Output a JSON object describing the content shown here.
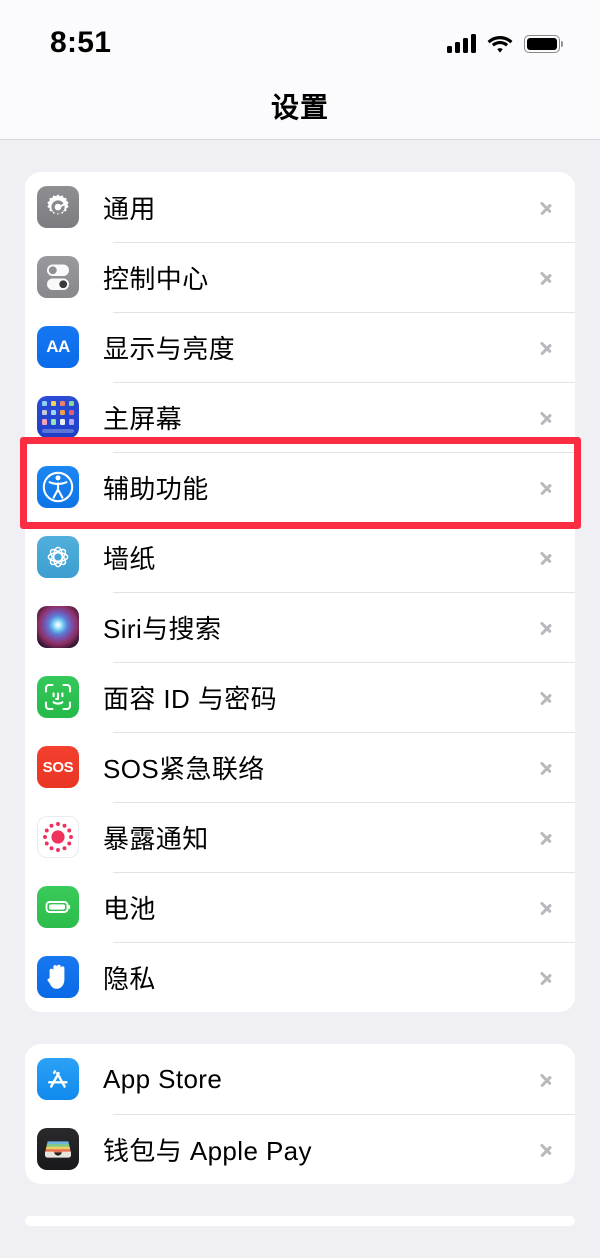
{
  "status_bar": {
    "time": "8:51",
    "icons": [
      "cellular-signal-icon",
      "wifi-icon",
      "battery-icon"
    ],
    "battery_level": 100
  },
  "nav": {
    "title": "设置"
  },
  "highlight": {
    "target": "辅助功能",
    "color": "#FA2D42"
  },
  "groups": [
    {
      "id": "system-group",
      "items": [
        {
          "label": "通用",
          "icon": "gear-icon",
          "chevron": "chevron-right-icon"
        },
        {
          "label": "控制中心",
          "icon": "control-center-icon",
          "chevron": "chevron-right-icon"
        },
        {
          "label": "显示与亮度",
          "icon": "display-brightness-icon",
          "chevron": "chevron-right-icon"
        },
        {
          "label": "主屏幕",
          "icon": "home-screen-icon",
          "chevron": "chevron-right-icon"
        },
        {
          "label": "辅助功能",
          "icon": "accessibility-icon",
          "chevron": "chevron-right-icon"
        },
        {
          "label": "墙纸",
          "icon": "wallpaper-icon",
          "chevron": "chevron-right-icon"
        },
        {
          "label": "Siri与搜索",
          "icon": "siri-icon",
          "chevron": "chevron-right-icon"
        },
        {
          "label": "面容 ID 与密码",
          "icon": "face-id-icon",
          "chevron": "chevron-right-icon"
        },
        {
          "label": "SOS紧急联络",
          "icon": "sos-icon",
          "chevron": "chevron-right-icon"
        },
        {
          "label": "暴露通知",
          "icon": "exposure-notification-icon",
          "chevron": "chevron-right-icon"
        },
        {
          "label": "电池",
          "icon": "battery-settings-icon",
          "chevron": "chevron-right-icon"
        },
        {
          "label": "隐私",
          "icon": "privacy-hand-icon",
          "chevron": "chevron-right-icon"
        }
      ]
    },
    {
      "id": "store-group",
      "items": [
        {
          "label": "App Store",
          "icon": "app-store-icon",
          "chevron": "chevron-right-icon"
        },
        {
          "label": "钱包与 Apple Pay",
          "icon": "wallet-icon",
          "chevron": "chevron-right-icon"
        }
      ]
    }
  ],
  "icon_labels": {
    "sos": "SOS",
    "display": "AA"
  }
}
